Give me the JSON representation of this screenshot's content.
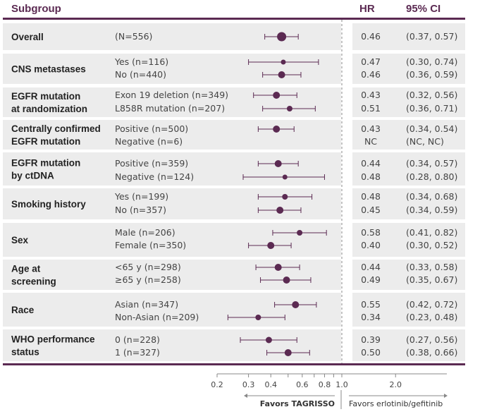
{
  "colors": {
    "accent": "#5b2a52",
    "band": "#ececec",
    "text": "#222222",
    "axis": "#888888"
  },
  "header": {
    "subgroup": "Subgroup",
    "hr": "HR",
    "ci": "95% CI"
  },
  "axis": {
    "favors_left": "Favors TAGRISSO",
    "favors_right": "Favors erlotinib/gefitinib"
  },
  "chart_data": {
    "type": "forest",
    "x_scale": "log",
    "reference_line": 1.0,
    "ticks": [
      {
        "value": 0.2,
        "label": "0.2"
      },
      {
        "value": 0.3,
        "label": "0.3"
      },
      {
        "value": 0.4,
        "label": "0.4"
      },
      {
        "value": 0.5,
        "label": ""
      },
      {
        "value": 0.6,
        "label": "0.6"
      },
      {
        "value": 0.7,
        "label": ""
      },
      {
        "value": 0.8,
        "label": "0.8"
      },
      {
        "value": 0.9,
        "label": ""
      },
      {
        "value": 1.0,
        "label": "1.0"
      },
      {
        "value": 2.0,
        "label": "2.0"
      }
    ],
    "xlim": [
      0.2,
      2.7
    ],
    "groups": [
      {
        "label": [
          "Overall"
        ],
        "rows": [
          {
            "sub": "(N=556)",
            "hr": 0.46,
            "lo": 0.37,
            "hi": 0.57,
            "hr_text": "0.46",
            "ci_text": "(0.37, 0.57)",
            "size": 6.5
          }
        ]
      },
      {
        "label": [
          "CNS metastases"
        ],
        "rows": [
          {
            "sub": "Yes (n=116)",
            "hr": 0.47,
            "lo": 0.3,
            "hi": 0.74,
            "hr_text": "0.47",
            "ci_text": "(0.30, 0.74)",
            "size": 3.5
          },
          {
            "sub": "No (n=440)",
            "hr": 0.46,
            "lo": 0.36,
            "hi": 0.59,
            "hr_text": "0.46",
            "ci_text": "(0.36, 0.59)",
            "size": 5
          }
        ]
      },
      {
        "label": [
          "EGFR mutation",
          "at randomization"
        ],
        "rows": [
          {
            "sub": "Exon 19 deletion (n=349)",
            "hr": 0.43,
            "lo": 0.32,
            "hi": 0.56,
            "hr_text": "0.43",
            "ci_text": "(0.32, 0.56)",
            "size": 5
          },
          {
            "sub": "L858R mutation (n=207)",
            "hr": 0.51,
            "lo": 0.36,
            "hi": 0.71,
            "hr_text": "0.51",
            "ci_text": "(0.36, 0.71)",
            "size": 4
          }
        ]
      },
      {
        "label": [
          "Centrally confirmed",
          "EGFR mutation"
        ],
        "rows": [
          {
            "sub": "Positive (n=500)",
            "hr": 0.43,
            "lo": 0.34,
            "hi": 0.54,
            "hr_text": "0.43",
            "ci_text": "(0.34, 0.54)",
            "size": 5
          },
          {
            "sub": "Negative (n=6)",
            "hr": null,
            "lo": null,
            "hi": null,
            "hr_text": "NC",
            "ci_text": "(NC, NC)",
            "size": 0
          }
        ]
      },
      {
        "label": [
          "EGFR mutation",
          "by ctDNA"
        ],
        "rows": [
          {
            "sub": "Positive (n=359)",
            "hr": 0.44,
            "lo": 0.34,
            "hi": 0.57,
            "hr_text": "0.44",
            "ci_text": "(0.34, 0.57)",
            "size": 5
          },
          {
            "sub": "Negative (n=124)",
            "hr": 0.48,
            "lo": 0.28,
            "hi": 0.8,
            "hr_text": "0.48",
            "ci_text": "(0.28, 0.80)",
            "size": 3.5
          }
        ]
      },
      {
        "label": [
          "Smoking history"
        ],
        "rows": [
          {
            "sub": "Yes (n=199)",
            "hr": 0.48,
            "lo": 0.34,
            "hi": 0.68,
            "hr_text": "0.48",
            "ci_text": "(0.34, 0.68)",
            "size": 4
          },
          {
            "sub": "No (n=357)",
            "hr": 0.45,
            "lo": 0.34,
            "hi": 0.59,
            "hr_text": "0.45",
            "ci_text": "(0.34, 0.59)",
            "size": 5
          }
        ]
      },
      {
        "label": [
          "Sex"
        ],
        "rows": [
          {
            "sub": "Male (n=206)",
            "hr": 0.58,
            "lo": 0.41,
            "hi": 0.82,
            "hr_text": "0.58",
            "ci_text": "(0.41, 0.82)",
            "size": 4
          },
          {
            "sub": "Female (n=350)",
            "hr": 0.4,
            "lo": 0.3,
            "hi": 0.52,
            "hr_text": "0.40",
            "ci_text": "(0.30, 0.52)",
            "size": 5
          }
        ]
      },
      {
        "label": [
          "Age at",
          "screening"
        ],
        "rows": [
          {
            "sub": "<65 y (n=298)",
            "hr": 0.44,
            "lo": 0.33,
            "hi": 0.58,
            "hr_text": "0.44",
            "ci_text": "(0.33, 0.58)",
            "size": 5
          },
          {
            "sub": "≥65 y (n=258)",
            "hr": 0.49,
            "lo": 0.35,
            "hi": 0.67,
            "hr_text": "0.49",
            "ci_text": "(0.35, 0.67)",
            "size": 5
          }
        ]
      },
      {
        "label": [
          "Race"
        ],
        "rows": [
          {
            "sub": "Asian (n=347)",
            "hr": 0.55,
            "lo": 0.42,
            "hi": 0.72,
            "hr_text": "0.55",
            "ci_text": "(0.42, 0.72)",
            "size": 5
          },
          {
            "sub": "Non-Asian (n=209)",
            "hr": 0.34,
            "lo": 0.23,
            "hi": 0.48,
            "hr_text": "0.34",
            "ci_text": "(0.23, 0.48)",
            "size": 4
          }
        ]
      },
      {
        "label": [
          "WHO performance",
          "status"
        ],
        "rows": [
          {
            "sub": "0 (n=228)",
            "hr": 0.39,
            "lo": 0.27,
            "hi": 0.56,
            "hr_text": "0.39",
            "ci_text": "(0.27, 0.56)",
            "size": 4.5
          },
          {
            "sub": "1 (n=327)",
            "hr": 0.5,
            "lo": 0.38,
            "hi": 0.66,
            "hr_text": "0.50",
            "ci_text": "(0.38, 0.66)",
            "size": 5
          }
        ]
      }
    ]
  }
}
